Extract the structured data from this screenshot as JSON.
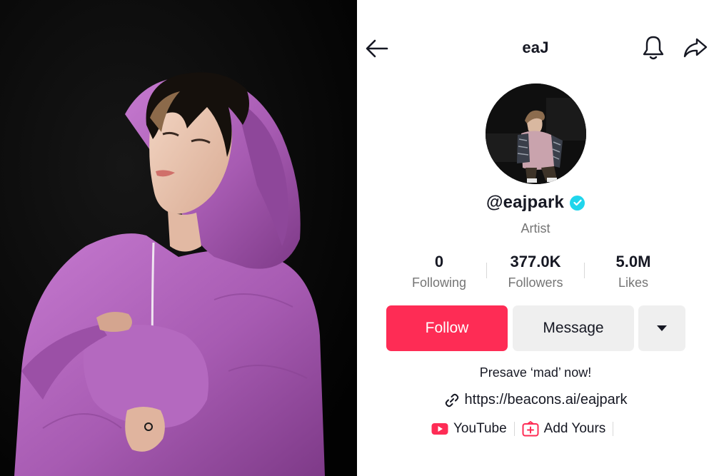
{
  "header": {
    "title": "eaJ",
    "back_icon": "arrow-left-icon",
    "bell_icon": "bell-icon",
    "share_icon": "share-arrow-icon"
  },
  "photo": {
    "description_icon": "portrait-photo"
  },
  "profile": {
    "handle": "@eajpark",
    "verified_icon": "verified-check-icon",
    "category": "Artist"
  },
  "stats": [
    {
      "value": "0",
      "label": "Following"
    },
    {
      "value": "377.0K",
      "label": "Followers"
    },
    {
      "value": "5.0M",
      "label": "Likes"
    }
  ],
  "actions": {
    "follow_label": "Follow",
    "message_label": "Message",
    "more_icon": "caret-down-icon"
  },
  "bio": {
    "text": "Presave ‘mad’ now!",
    "link_icon": "link-icon",
    "link": "https://beacons.ai/eajpark"
  },
  "pills": [
    {
      "label": "YouTube",
      "icon": "youtube-icon"
    },
    {
      "label": "Add Yours",
      "icon": "add-yours-icon"
    }
  ],
  "colors": {
    "accent": "#fe2c55",
    "verified": "#20d5ec",
    "secondary_text": "#757575",
    "button_bg": "#efefef"
  }
}
